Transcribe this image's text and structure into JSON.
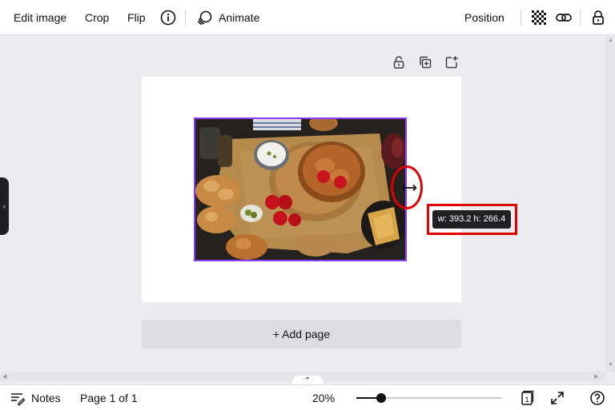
{
  "toolbar": {
    "edit_image": "Edit image",
    "crop": "Crop",
    "flip": "Flip",
    "info_icon": "info-icon",
    "animate": "Animate",
    "position": "Position",
    "transparency_icon": "checkerboard-icon",
    "link_icon": "link-icon",
    "lock_icon": "lock-icon"
  },
  "page_tools": [
    "lock-icon",
    "duplicate-page-icon",
    "add-page-icon"
  ],
  "selection": {
    "dimensions_tooltip": "w: 393.2 h: 266.4"
  },
  "canvas": {
    "add_page_label": "+ Add page"
  },
  "bottombar": {
    "notes_label": "Notes",
    "page_indicator": "Page 1 of 1",
    "zoom_label": "20%",
    "zoom_fraction": 0.17,
    "page_count_badge": "1"
  },
  "colors": {
    "accent": "#8b3dff",
    "highlight": "#e00000",
    "canvas_bg": "#ebecf0"
  }
}
